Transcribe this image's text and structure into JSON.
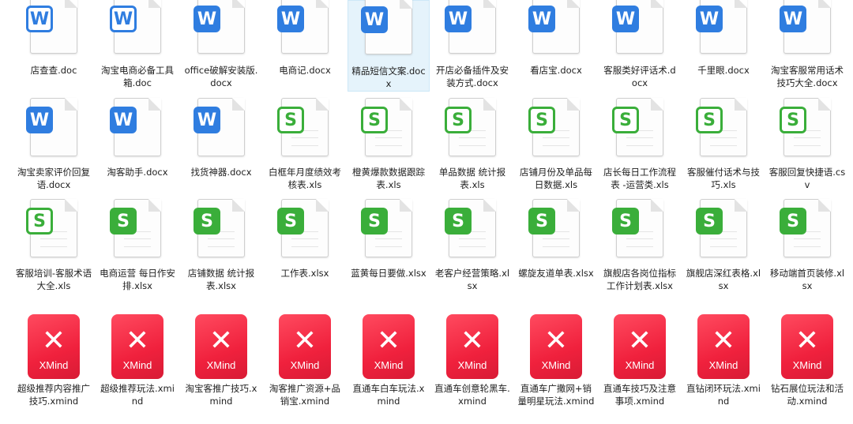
{
  "files": [
    {
      "name": "店查查.doc",
      "type": "doc-old"
    },
    {
      "name": "淘宝电商必备工具箱.doc",
      "type": "doc-old"
    },
    {
      "name": "office破解安装版.docx",
      "type": "doc"
    },
    {
      "name": "电商记.docx",
      "type": "doc"
    },
    {
      "name": "精品短信文案.docx",
      "type": "doc",
      "selected": true
    },
    {
      "name": "开店必备插件及安装方式.docx",
      "type": "doc"
    },
    {
      "name": "看店宝.docx",
      "type": "doc"
    },
    {
      "name": "客服类好评话术.docx",
      "type": "doc"
    },
    {
      "name": "千里眼.docx",
      "type": "doc"
    },
    {
      "name": "淘宝客服常用话术技巧大全.docx",
      "type": "doc"
    },
    {
      "name": "淘宝卖家评价回复语.docx",
      "type": "doc"
    },
    {
      "name": "淘客助手.docx",
      "type": "doc"
    },
    {
      "name": "找货神器.docx",
      "type": "doc"
    },
    {
      "name": "白框年月度绩效考核表.xls",
      "type": "xls-old"
    },
    {
      "name": "橙黄爆款数据跟踪表.xls",
      "type": "xls-old"
    },
    {
      "name": "单品数据 统计报表.xls",
      "type": "xls-old"
    },
    {
      "name": "店铺月份及单品每日数据.xls",
      "type": "xls-old"
    },
    {
      "name": "店长每日工作流程表 -运营类.xls",
      "type": "xls-old"
    },
    {
      "name": "客服催付话术与技巧.xls",
      "type": "xls-old"
    },
    {
      "name": "客服回复快捷语.csv",
      "type": "xls-old"
    },
    {
      "name": "客服培训-客服术语大全.xls",
      "type": "xls-old"
    },
    {
      "name": "电商运营 每日作安排.xlsx",
      "type": "xls"
    },
    {
      "name": "店铺数据 统计报表.xlsx",
      "type": "xls"
    },
    {
      "name": "工作表.xlsx",
      "type": "xls"
    },
    {
      "name": "蓝黄每日要做.xlsx",
      "type": "xls"
    },
    {
      "name": "老客户经营策略.xlsx",
      "type": "xls"
    },
    {
      "name": "螺旋友道单表.xlsx",
      "type": "xls"
    },
    {
      "name": "旗舰店各岗位指标工作计划表.xlsx",
      "type": "xls"
    },
    {
      "name": "旗舰店深红表格.xlsx",
      "type": "xls"
    },
    {
      "name": "移动端首页装修.xlsx",
      "type": "xls"
    },
    {
      "name": "超级推荐内容推广技巧.xmind",
      "type": "xmind"
    },
    {
      "name": "超级推荐玩法.xmind",
      "type": "xmind"
    },
    {
      "name": "淘宝客推广技巧.xmind",
      "type": "xmind"
    },
    {
      "name": "淘客推广资源+品销宝.xmind",
      "type": "xmind"
    },
    {
      "name": "直通车白车玩法.xmind",
      "type": "xmind"
    },
    {
      "name": "直通车创意轮黑车.xmind",
      "type": "xmind"
    },
    {
      "name": "直通车广撒网+销量明星玩法.xmind",
      "type": "xmind"
    },
    {
      "name": "直通车技巧及注意事项.xmind",
      "type": "xmind"
    },
    {
      "name": "直钻闭环玩法.xmind",
      "type": "xmind"
    },
    {
      "name": "钻石展位玩法和活动.xmind",
      "type": "xmind"
    }
  ],
  "icons": {
    "doc": "W",
    "xls": "S",
    "xmind_glyph": "✕",
    "xmind_text": "XMind"
  },
  "colors": {
    "word": "#2f7de0",
    "excel": "#3aae3a",
    "xmind": "#f0213d",
    "selection": "#e5f3fb"
  }
}
